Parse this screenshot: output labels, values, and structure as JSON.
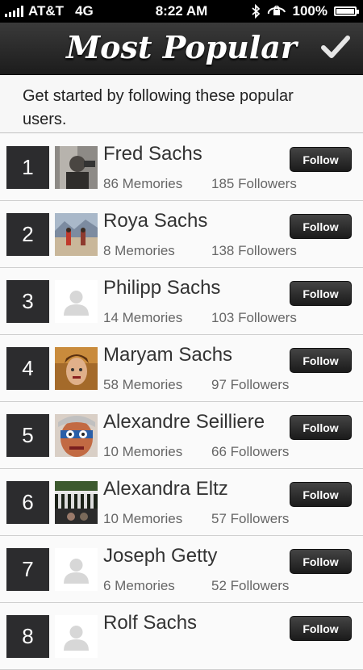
{
  "status_bar": {
    "carrier": "AT&T",
    "network": "4G",
    "time": "8:22 AM",
    "battery": "100%",
    "battery_level": 1.0,
    "icons": [
      "signal-icon",
      "bluetooth-icon",
      "lock-rotation-icon",
      "battery-icon"
    ]
  },
  "nav": {
    "title": "Most Popular",
    "done_icon": "checkmark-icon"
  },
  "intro": "Get started by following these popular users.",
  "colors": {
    "nav_bg": "#2a2a2a",
    "rank_bg": "#2c2c2e",
    "button_bg": "#2b2b2b",
    "row_bg": "#fafafa"
  },
  "users": [
    {
      "rank": "1",
      "name": "Fred Sachs",
      "memories": "86 Memories",
      "followers": "185 Followers",
      "follow": "Follow",
      "avatar": "photo"
    },
    {
      "rank": "2",
      "name": "Roya Sachs",
      "memories": "8 Memories",
      "followers": "138 Followers",
      "follow": "Follow",
      "avatar": "photo"
    },
    {
      "rank": "3",
      "name": "Philipp Sachs",
      "memories": "14 Memories",
      "followers": "103 Followers",
      "follow": "Follow",
      "avatar": "placeholder"
    },
    {
      "rank": "4",
      "name": "Maryam Sachs",
      "memories": "58 Memories",
      "followers": "97 Followers",
      "follow": "Follow",
      "avatar": "photo"
    },
    {
      "rank": "5",
      "name": "Alexandre Seilliere",
      "memories": "10 Memories",
      "followers": "66 Followers",
      "follow": "Follow",
      "avatar": "photo"
    },
    {
      "rank": "6",
      "name": "Alexandra Eltz",
      "memories": "10 Memories",
      "followers": "57 Followers",
      "follow": "Follow",
      "avatar": "photo"
    },
    {
      "rank": "7",
      "name": "Joseph Getty",
      "memories": "6 Memories",
      "followers": "52 Followers",
      "follow": "Follow",
      "avatar": "placeholder"
    },
    {
      "rank": "8",
      "name": "Rolf Sachs",
      "memories": "",
      "followers": "",
      "follow": "Follow",
      "avatar": "placeholder"
    }
  ]
}
